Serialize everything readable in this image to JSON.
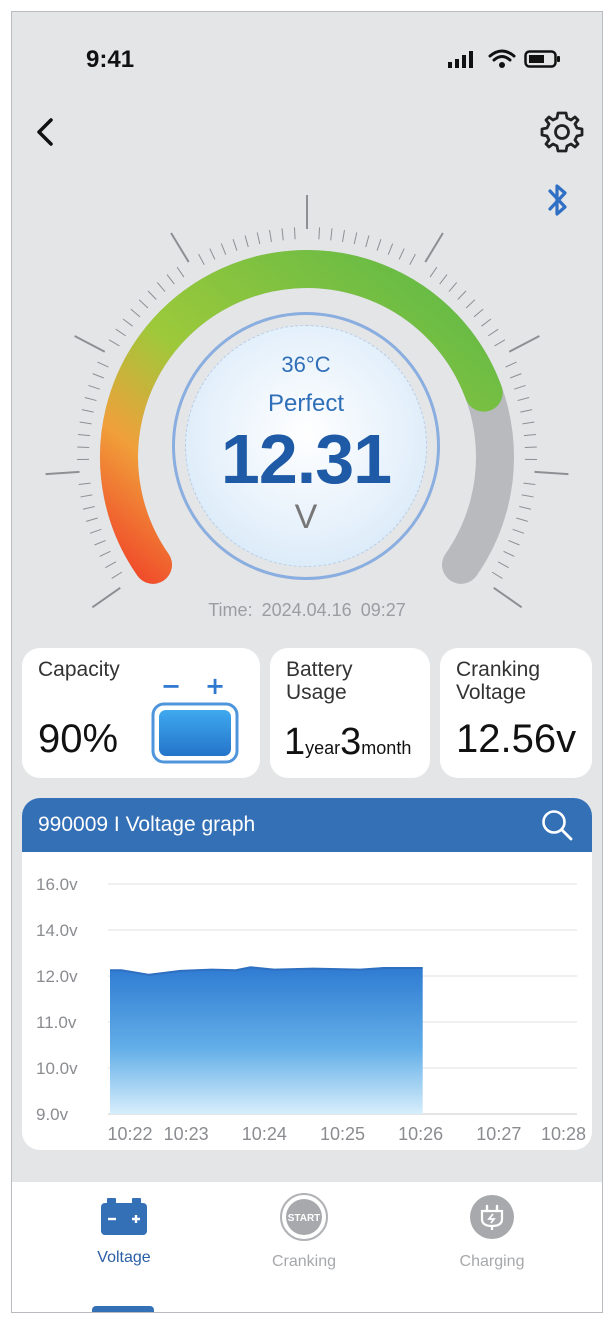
{
  "status_bar": {
    "time": "9:41"
  },
  "gauge": {
    "temperature": "36°C",
    "status": "Perfect",
    "voltage": "12.31",
    "unit": "V",
    "level": 0.78,
    "time_label": "Time:",
    "date": "2024.04.16",
    "clock": "09:27",
    "colors": {
      "low": "#f04a2a",
      "mid": "#9cc93a",
      "high": "#5cb848",
      "track": "#b9babd"
    }
  },
  "cards": {
    "capacity": {
      "label": "Capacity",
      "value": "90%",
      "battery_minus": "−",
      "battery_plus": "+"
    },
    "usage": {
      "label_line1": "Battery",
      "label_line2": "Usage",
      "years": "1",
      "year_unit": "year",
      "months": "3",
      "month_unit": "month"
    },
    "cranking": {
      "label_line1": "Cranking",
      "label_line2": "Voltage",
      "value": "12.56v"
    }
  },
  "graph": {
    "title": "990009 I Voltage graph"
  },
  "chart_data": {
    "type": "area",
    "title": "990009 I Voltage graph",
    "y_tick_labels": [
      "16.0v",
      "14.0v",
      "12.0v",
      "11.0v",
      "10.0v",
      "9.0v"
    ],
    "x": [
      "10:22",
      "10:23",
      "10:24",
      "10:25",
      "10:26",
      "10:27",
      "10:28"
    ],
    "series": [
      {
        "points": [
          [
            0,
            12.25
          ],
          [
            0.15,
            12.25
          ],
          [
            0.5,
            12.05
          ],
          [
            0.9,
            12.22
          ],
          [
            1.3,
            12.28
          ],
          [
            1.6,
            12.25
          ],
          [
            1.8,
            12.38
          ],
          [
            2.1,
            12.28
          ],
          [
            2.6,
            12.32
          ],
          [
            3.2,
            12.28
          ],
          [
            3.5,
            12.35
          ],
          [
            4.0,
            12.35
          ]
        ]
      }
    ],
    "color": "#3d86d4"
  },
  "tabs": [
    {
      "label": "Voltage",
      "active": true
    },
    {
      "label": "Cranking",
      "icon_text": "START",
      "active": false
    },
    {
      "label": "Charging",
      "active": false
    }
  ]
}
